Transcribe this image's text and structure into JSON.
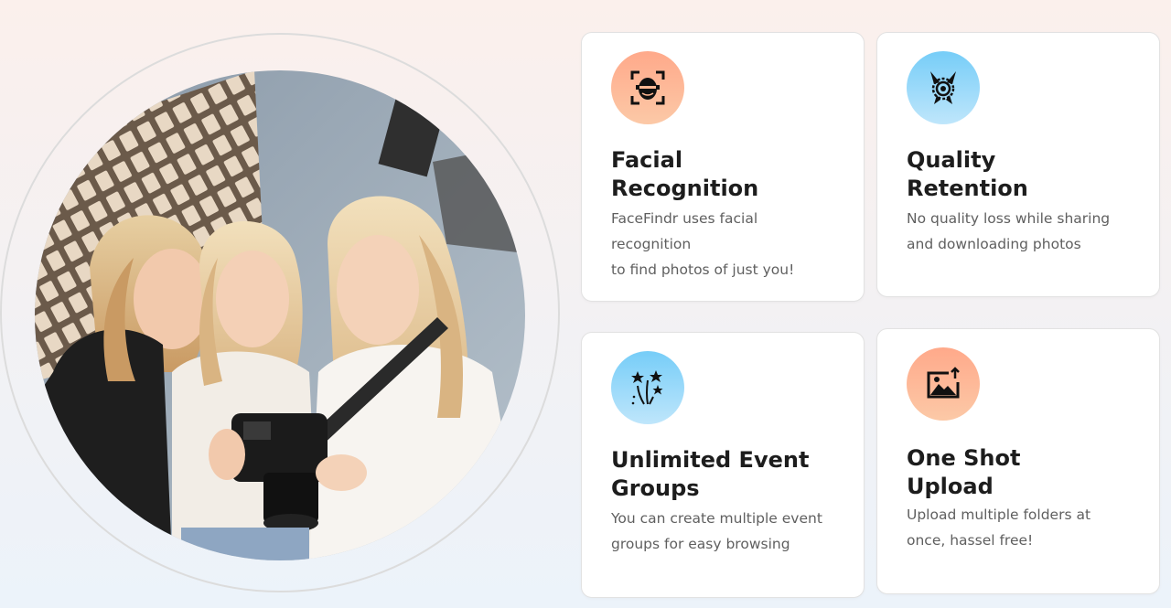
{
  "photo": {
    "alt_subject": "photographers-reviewing-camera"
  },
  "features": [
    {
      "icon": "facial-recognition-icon",
      "icon_bg": "orange",
      "title": "Facial\nRecognition",
      "description": "FaceFindr uses facial\nrecognition\nto find photos of just you!"
    },
    {
      "icon": "quality-badge-icon",
      "icon_bg": "blue",
      "title": "Quality\nRetention",
      "description": "No quality loss while sharing\nand downloading photos"
    },
    {
      "icon": "fireworks-stars-icon",
      "icon_bg": "blue",
      "title": "Unlimited Event\nGroups",
      "description": "You can create multiple event\ngroups for easy browsing"
    },
    {
      "icon": "image-upload-icon",
      "icon_bg": "orange",
      "title": "One Shot\nUpload",
      "description": "Upload multiple folders at\nonce, hassel free!"
    }
  ],
  "colors": {
    "icon_orange": "#ffa98a",
    "icon_blue": "#76cdf8",
    "title_text": "#1d1d1d",
    "body_text": "#5f5f5f"
  }
}
